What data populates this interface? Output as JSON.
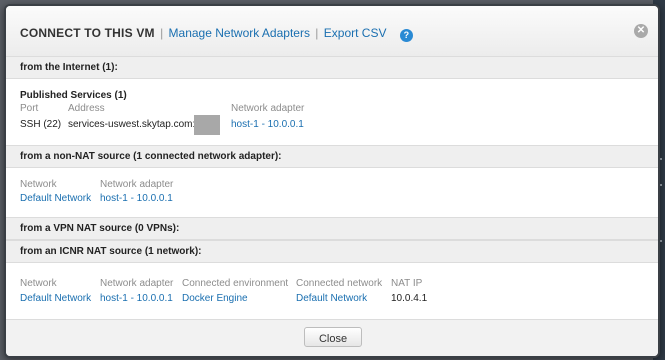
{
  "header": {
    "title": "CONNECT TO THIS VM",
    "separator": "|",
    "links": [
      "Manage Network Adapters",
      "Export CSV"
    ],
    "help_icon": "question-mark-icon",
    "help_glyph": "?",
    "close_icon": "close-circle-icon",
    "close_glyph": "✕"
  },
  "internet": {
    "heading": "from the Internet (1):",
    "published_services_title": "Published Services (1)",
    "columns": [
      "Port",
      "Address",
      "Network adapter"
    ],
    "row": {
      "port": "SSH (22)",
      "address": "services-uswest.skytap.com:",
      "adapter": "host-1 - 10.0.0.1"
    }
  },
  "non_nat": {
    "heading": "from a non-NAT source (1 connected network adapter):",
    "columns": [
      "Network",
      "Network adapter"
    ],
    "row": {
      "network": "Default Network",
      "adapter": "host-1 - 10.0.0.1"
    }
  },
  "vpn": {
    "heading": "from a VPN NAT source (0 VPNs):"
  },
  "icnr": {
    "heading": "from an ICNR NAT source (1 network):",
    "columns": [
      "Network",
      "Network adapter",
      "Connected environment",
      "Connected network",
      "NAT IP"
    ],
    "row": {
      "network": "Default Network",
      "adapter": "host-1 - 10.0.0.1",
      "environment": "Docker Engine",
      "connected_network": "Default Network",
      "nat_ip": "10.0.4.1"
    }
  },
  "footer": {
    "close_label": "Close"
  },
  "colors": {
    "link": "#1a6fb0",
    "help": "#2a8ad4",
    "section_band": "#efefef"
  }
}
